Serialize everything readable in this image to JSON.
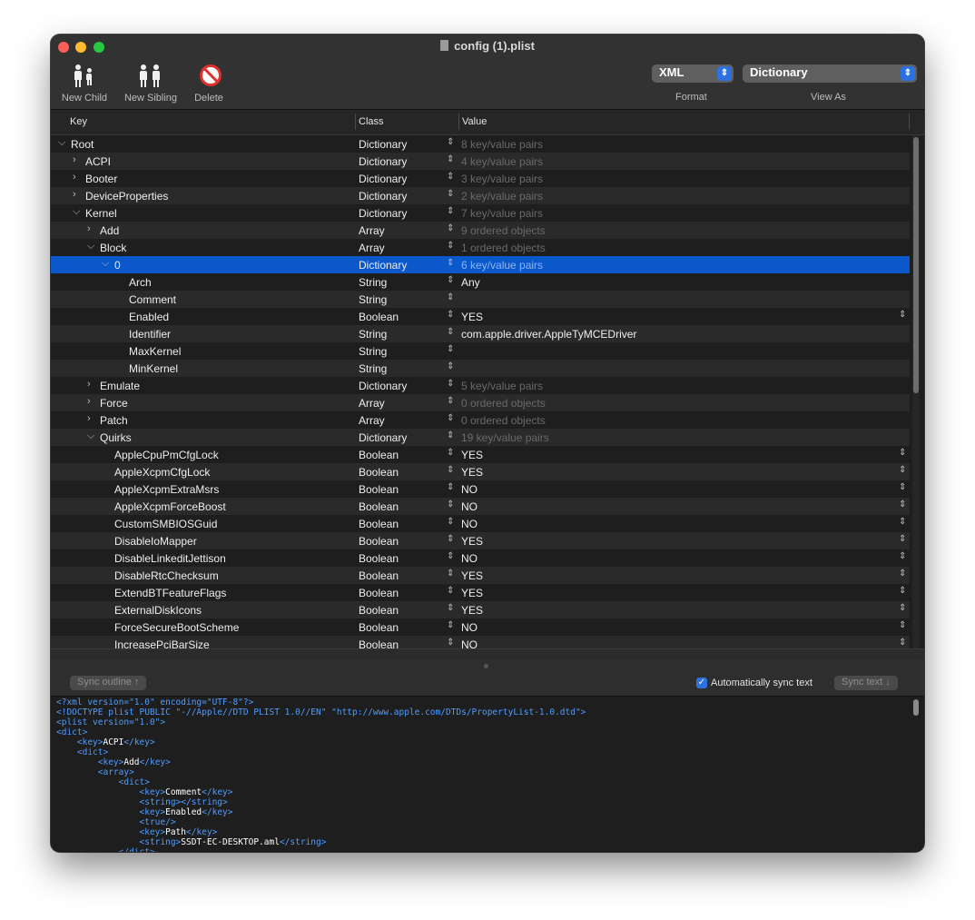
{
  "window": {
    "title": "config (1).plist"
  },
  "toolbar": {
    "new_child": "New Child",
    "new_sibling": "New Sibling",
    "delete": "Delete",
    "format_value": "XML",
    "format_label": "Format",
    "viewas_value": "Dictionary",
    "viewas_label": "View As"
  },
  "columns": {
    "key": "Key",
    "class": "Class",
    "value": "Value"
  },
  "rows": [
    {
      "key": "Root",
      "disclosure": "⌵",
      "class": "Dictionary",
      "value": "8 key/value pairs",
      "dim": true
    },
    {
      "key": "ACPI",
      "disclosure": "›",
      "class": "Dictionary",
      "value": "4 key/value pairs",
      "dim": true
    },
    {
      "key": "Booter",
      "disclosure": "›",
      "class": "Dictionary",
      "value": "3 key/value pairs",
      "dim": true
    },
    {
      "key": "DeviceProperties",
      "disclosure": "›",
      "class": "Dictionary",
      "value": "2 key/value pairs",
      "dim": true
    },
    {
      "key": "Kernel",
      "disclosure": "⌵",
      "class": "Dictionary",
      "value": "7 key/value pairs",
      "dim": true
    },
    {
      "key": "Add",
      "disclosure": "›",
      "class": "Array",
      "value": "9 ordered objects",
      "dim": true
    },
    {
      "key": "Block",
      "disclosure": "⌵",
      "class": "Array",
      "value": "1 ordered objects",
      "dim": true
    },
    {
      "key": "0",
      "disclosure": "⌵",
      "class": "Dictionary",
      "value": "6 key/value pairs",
      "dim": true
    },
    {
      "key": "Arch",
      "class": "String",
      "value": "Any"
    },
    {
      "key": "Comment",
      "class": "String",
      "value": ""
    },
    {
      "key": "Enabled",
      "class": "Boolean",
      "value": "YES"
    },
    {
      "key": "Identifier",
      "class": "String",
      "value": "com.apple.driver.AppleTyMCEDriver"
    },
    {
      "key": "MaxKernel",
      "class": "String",
      "value": ""
    },
    {
      "key": "MinKernel",
      "class": "String",
      "value": ""
    },
    {
      "key": "Emulate",
      "disclosure": "›",
      "class": "Dictionary",
      "value": "5 key/value pairs",
      "dim": true
    },
    {
      "key": "Force",
      "disclosure": "›",
      "class": "Array",
      "value": "0 ordered objects",
      "dim": true
    },
    {
      "key": "Patch",
      "disclosure": "›",
      "class": "Array",
      "value": "0 ordered objects",
      "dim": true
    },
    {
      "key": "Quirks",
      "disclosure": "⌵",
      "class": "Dictionary",
      "value": "19 key/value pairs",
      "dim": true
    },
    {
      "key": "AppleCpuPmCfgLock",
      "class": "Boolean",
      "value": "YES"
    },
    {
      "key": "AppleXcpmCfgLock",
      "class": "Boolean",
      "value": "YES"
    },
    {
      "key": "AppleXcpmExtraMsrs",
      "class": "Boolean",
      "value": "NO"
    },
    {
      "key": "AppleXcpmForceBoost",
      "class": "Boolean",
      "value": "NO"
    },
    {
      "key": "CustomSMBIOSGuid",
      "class": "Boolean",
      "value": "NO"
    },
    {
      "key": "DisableIoMapper",
      "class": "Boolean",
      "value": "YES"
    },
    {
      "key": "DisableLinkeditJettison",
      "class": "Boolean",
      "value": "NO"
    },
    {
      "key": "DisableRtcChecksum",
      "class": "Boolean",
      "value": "YES"
    },
    {
      "key": "ExtendBTFeatureFlags",
      "class": "Boolean",
      "value": "YES"
    },
    {
      "key": "ExternalDiskIcons",
      "class": "Boolean",
      "value": "YES"
    },
    {
      "key": "ForceSecureBootScheme",
      "class": "Boolean",
      "value": "NO"
    },
    {
      "key": "IncreasePciBarSize",
      "class": "Boolean",
      "value": "NO"
    }
  ],
  "sync": {
    "outline_button": "Sync outline ↑",
    "auto_label": "Automatically sync text",
    "text_button": "Sync text ↓"
  },
  "xml": [
    [
      [
        "tag",
        "<?xml version=\"1.0\" encoding=\"UTF-8\"?>"
      ]
    ],
    [
      [
        "tag",
        "<!DOCTYPE plist PUBLIC \"-//Apple//DTD PLIST 1.0//EN\" \"http://www.apple.com/DTDs/PropertyList-1.0.dtd\">"
      ]
    ],
    [
      [
        "tag",
        "<plist version=\"1.0\">"
      ]
    ],
    [
      [
        "tag",
        "<dict>"
      ]
    ],
    [
      [
        "tag",
        "    <key>"
      ],
      [
        "txt",
        "ACPI"
      ],
      [
        "tag",
        "</key>"
      ]
    ],
    [
      [
        "tag",
        "    <dict>"
      ]
    ],
    [
      [
        "tag",
        "        <key>"
      ],
      [
        "txt",
        "Add"
      ],
      [
        "tag",
        "</key>"
      ]
    ],
    [
      [
        "tag",
        "        <array>"
      ]
    ],
    [
      [
        "tag",
        "            <dict>"
      ]
    ],
    [
      [
        "tag",
        "                <key>"
      ],
      [
        "txt",
        "Comment"
      ],
      [
        "tag",
        "</key>"
      ]
    ],
    [
      [
        "tag",
        "                <string></string>"
      ]
    ],
    [
      [
        "tag",
        "                <key>"
      ],
      [
        "txt",
        "Enabled"
      ],
      [
        "tag",
        "</key>"
      ]
    ],
    [
      [
        "tag",
        "                <true/>"
      ]
    ],
    [
      [
        "tag",
        "                <key>"
      ],
      [
        "txt",
        "Path"
      ],
      [
        "tag",
        "</key>"
      ]
    ],
    [
      [
        "tag",
        "                <string>"
      ],
      [
        "txt",
        "SSDT-EC-DESKTOP.aml"
      ],
      [
        "tag",
        "</string>"
      ]
    ],
    [
      [
        "tag",
        "            </dict>"
      ]
    ]
  ]
}
